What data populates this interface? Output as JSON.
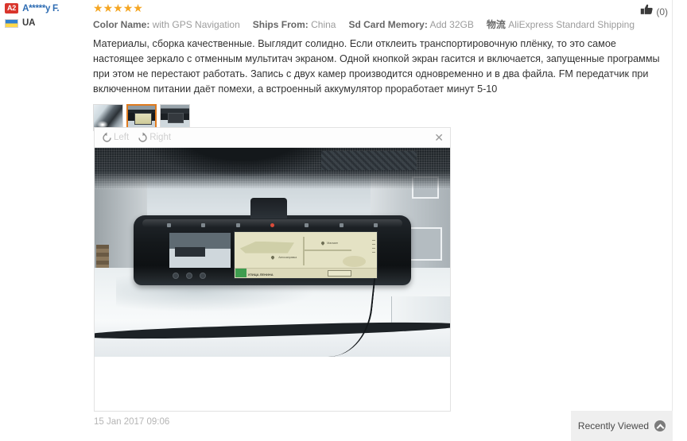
{
  "reviewer": {
    "level_badge": "A2",
    "name": "A*****y F.",
    "country_code": "UA",
    "flag_icon": "ukraine-flag-icon"
  },
  "rating": {
    "stars_filled": 5,
    "star_glyph": "★",
    "star_color": "#f5a623"
  },
  "helpful": {
    "icon": "thumbs-up-icon",
    "count_label": "(0)"
  },
  "attributes": [
    {
      "key": "Color Name:",
      "value": "with GPS Navigation"
    },
    {
      "key": "Ships From:",
      "value": "China"
    },
    {
      "key": "Sd Card Memory:",
      "value": "Add 32GB"
    },
    {
      "key": "物流",
      "value": "AliExpress Standard Shipping"
    }
  ],
  "review_text": "Материалы, сборка качественные. Выглядит солидно. Если отклеить транспортировочную плёнку, то это самое настоящее зеркало с отменным мультитач экраном. Одной кнопкой экран гасится и включается, запущенные программы при этом не перестают работать. Запись с двух камер производится одновременно и в два файла. FM передатчик при включенном питании даёт помехи, а встроенный аккумулятор проработает минут 5-10",
  "thumbnails": [
    {
      "alt": "mirror-dashcam-reflective-photo",
      "selected": false
    },
    {
      "alt": "mirror-dashcam-navigation-screen-photo",
      "selected": true
    },
    {
      "alt": "mirror-dashcam-screen-off-photo",
      "selected": false
    }
  ],
  "viewer": {
    "rotate_left_label": "Left",
    "rotate_left_icon": "rotate-left-icon",
    "rotate_right_label": "Right",
    "rotate_right_icon": "rotate-right-icon",
    "close_icon": "close-icon",
    "close_glyph": "✕",
    "photo_alt": "car-rearview-mirror-dashcam-with-gps-navigation-snowy-street",
    "nav_screen": {
      "street_label": "УЛИЦА ЛЕНИНА",
      "poi_label_a": "Автозаправка",
      "poi_label_b": "Магазин"
    }
  },
  "timestamp": "15 Jan 2017 09:06",
  "recently_viewed": {
    "label": "Recently Viewed",
    "icon": "chevron-up-circle-icon"
  }
}
